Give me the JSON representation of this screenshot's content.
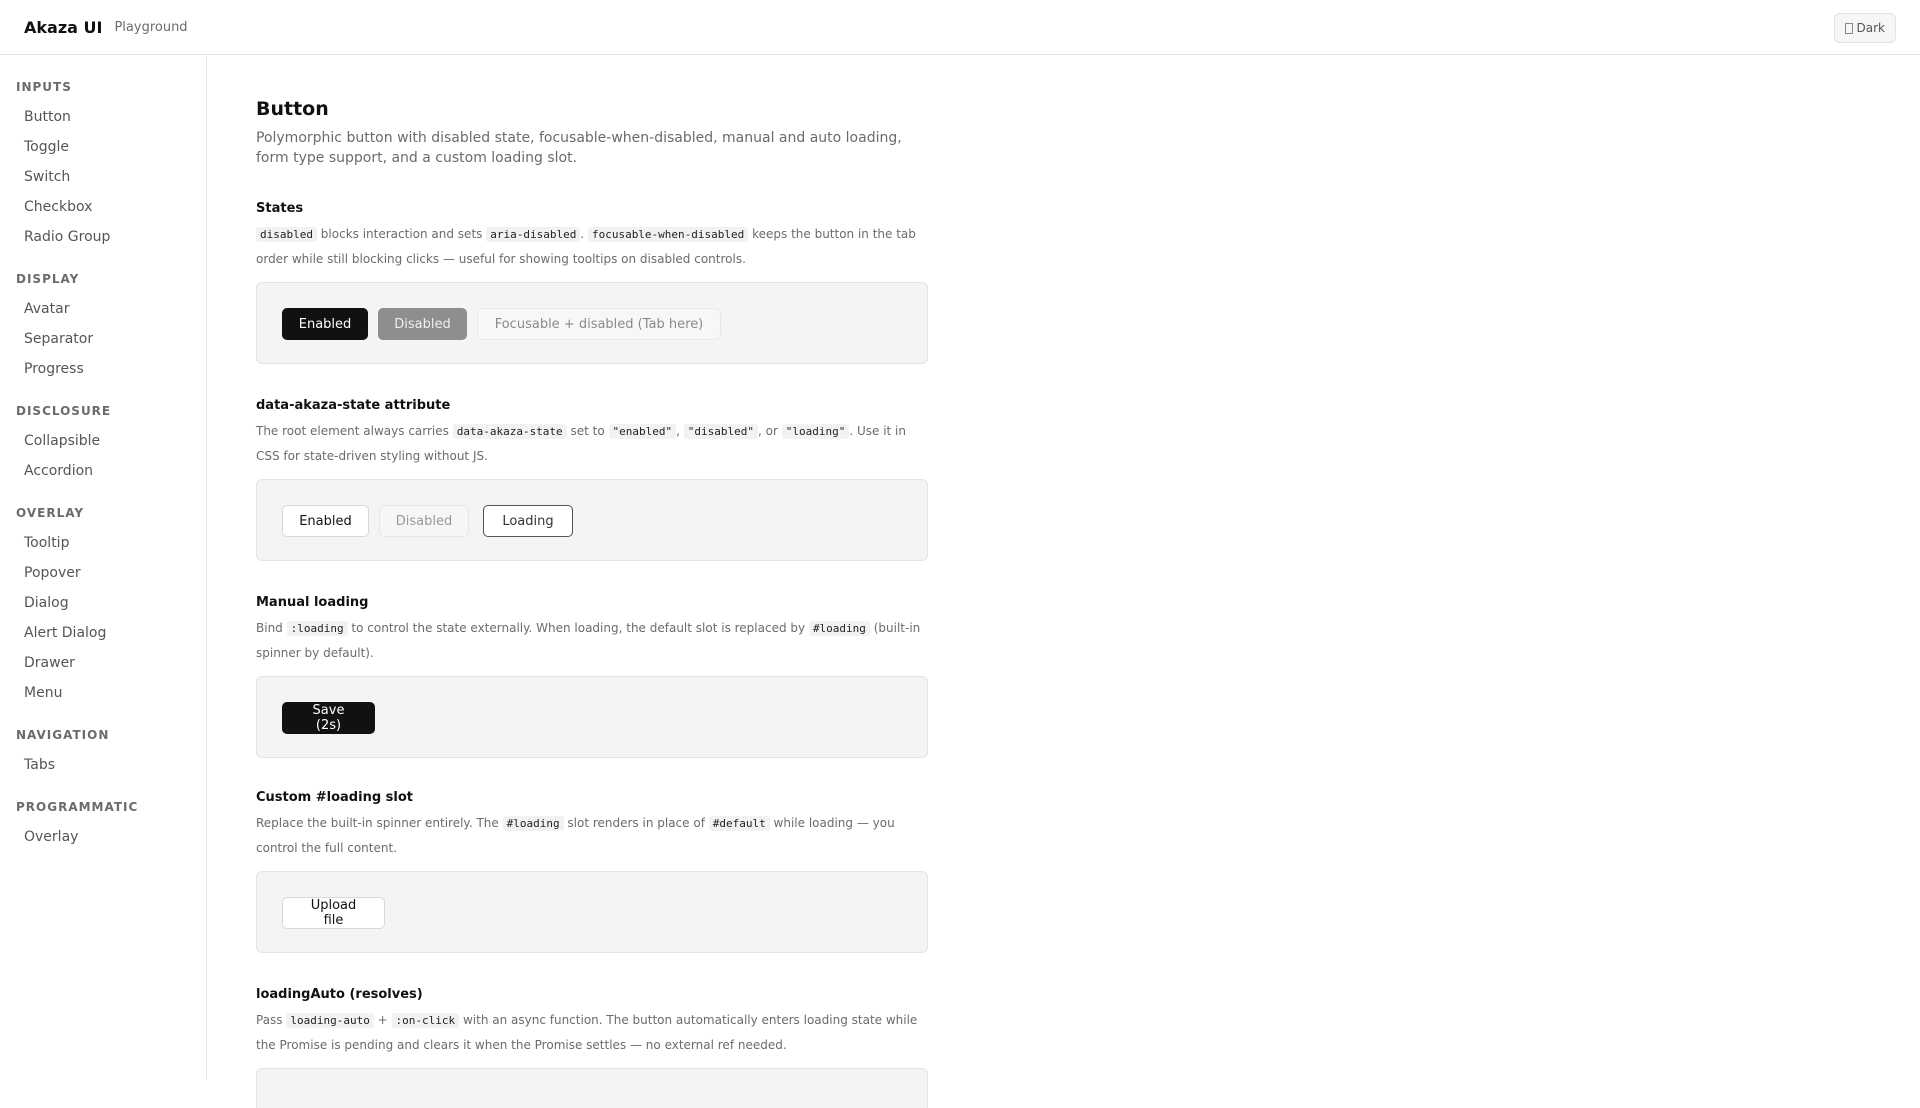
{
  "header": {
    "brand": "Akaza UI",
    "subtitle": "Playground",
    "theme_label": "Dark"
  },
  "sidebar": {
    "groups": [
      {
        "title": "INPUTS",
        "items": [
          "Button",
          "Toggle",
          "Switch",
          "Checkbox",
          "Radio Group"
        ]
      },
      {
        "title": "DISPLAY",
        "items": [
          "Avatar",
          "Separator",
          "Progress"
        ]
      },
      {
        "title": "DISCLOSURE",
        "items": [
          "Collapsible",
          "Accordion"
        ]
      },
      {
        "title": "OVERLAY",
        "items": [
          "Tooltip",
          "Popover",
          "Dialog",
          "Alert Dialog",
          "Drawer",
          "Menu"
        ]
      },
      {
        "title": "NAVIGATION",
        "items": [
          "Tabs"
        ]
      },
      {
        "title": "PROGRAMMATIC",
        "items": [
          "Overlay"
        ]
      }
    ]
  },
  "page": {
    "title": "Button",
    "description": "Polymorphic button with disabled state, focusable-when-disabled, manual and auto loading, form type support, and a custom loading slot."
  },
  "sections": {
    "states": {
      "title": "States",
      "code_disabled": "disabled",
      "text_1": " blocks interaction and sets ",
      "code_aria": "aria-disabled",
      "text_2": ". ",
      "code_focusable": "focusable-when-disabled",
      "text_3": " keeps the button in the tab order while still blocking clicks — useful for showing tooltips on disabled controls.",
      "buttons": [
        "Enabled",
        "Disabled",
        "Focusable + disabled (Tab here)"
      ]
    },
    "state_attr": {
      "title": "data-akaza-state attribute",
      "text_1": "The root element always carries ",
      "code_attr": "data-akaza-state",
      "text_2": " set to ",
      "code_enabled": "\"enabled\"",
      "text_3": ", ",
      "code_disabled": "\"disabled\"",
      "text_4": ", or ",
      "code_loading": "\"loading\"",
      "text_5": ". Use it in CSS for state-driven styling without JS.",
      "buttons": [
        "Enabled",
        "Disabled",
        "Loading"
      ]
    },
    "manual": {
      "title": "Manual loading",
      "text_1": "Bind ",
      "code_loading": ":loading",
      "text_2": " to control the state externally. When loading, the default slot is replaced by ",
      "code_slot": "#loading",
      "text_3": " (built-in spinner by default).",
      "button": "Save (2s)"
    },
    "custom_slot": {
      "title": "Custom #loading slot",
      "text_1": "Replace the built-in spinner entirely. The ",
      "code_loading": "#loading",
      "text_2": " slot renders in place of ",
      "code_default": "#default",
      "text_3": " while loading — you control the full content.",
      "button": "Upload file"
    },
    "auto": {
      "title": "loadingAuto (resolves)",
      "text_1": "Pass ",
      "code_auto": "loading-auto",
      "text_2": " + ",
      "code_click": ":on-click",
      "text_3": " with an async function. The button automatically enters loading state while the Promise is pending and clears it when the Promise settles — no external ref needed."
    }
  }
}
